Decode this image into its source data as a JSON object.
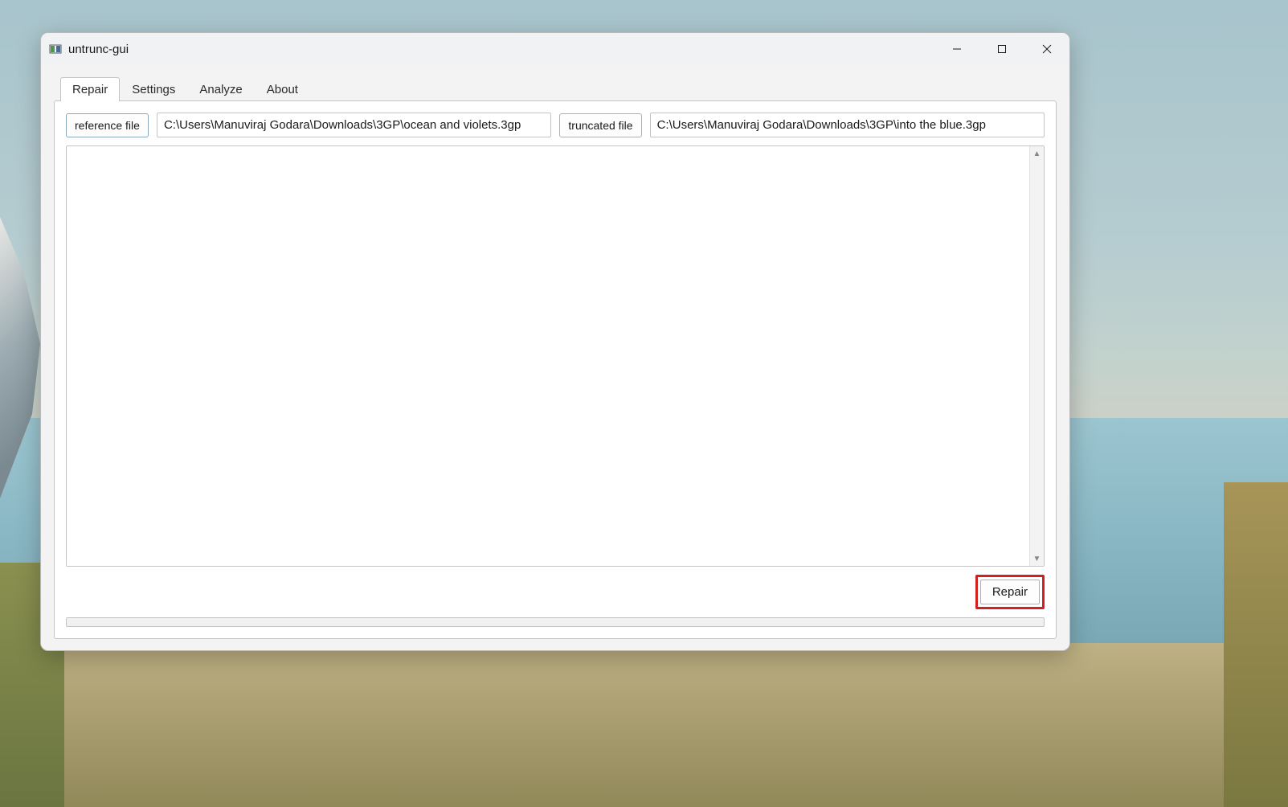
{
  "window": {
    "title": "untrunc-gui"
  },
  "tabs": [
    {
      "label": "Repair",
      "active": true
    },
    {
      "label": "Settings",
      "active": false
    },
    {
      "label": "Analyze",
      "active": false
    },
    {
      "label": "About",
      "active": false
    }
  ],
  "files": {
    "reference_button_label": "reference file",
    "reference_path": "C:\\Users\\Manuviraj Godara\\Downloads\\3GP\\ocean and violets.3gp",
    "truncated_button_label": "truncated file",
    "truncated_path": "C:\\Users\\Manuviraj Godara\\Downloads\\3GP\\into the blue.3gp"
  },
  "action": {
    "repair_label": "Repair"
  }
}
